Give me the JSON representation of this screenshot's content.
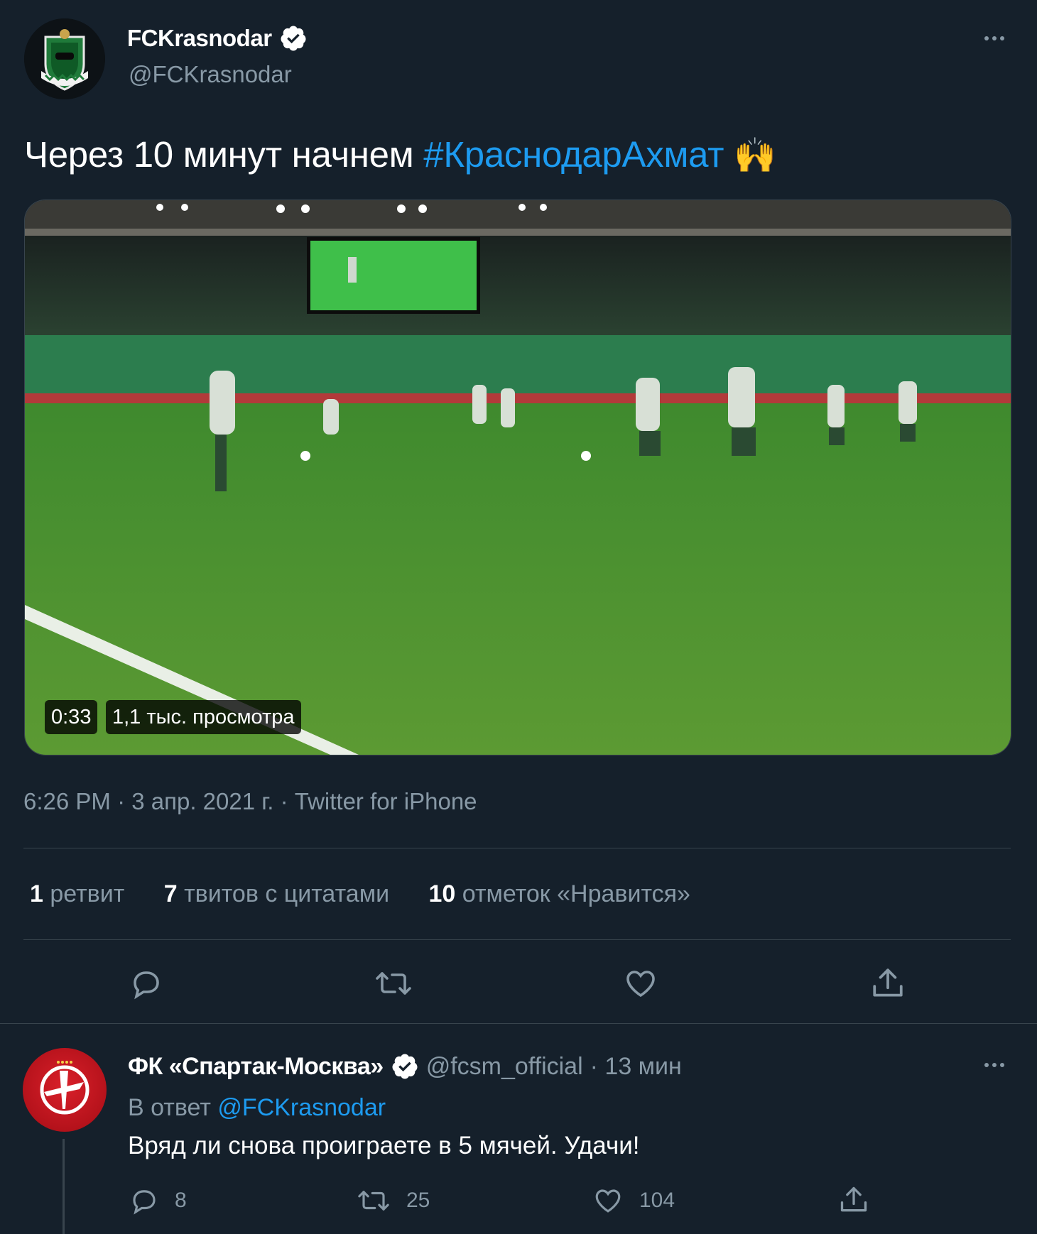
{
  "tweet": {
    "author_name": "FCKrasnodar",
    "author_handle": "@FCKrasnodar",
    "text_plain": "Через 10 минут начнем ",
    "hashtag": "#КраснодарАхмат",
    "emoji": "🙌",
    "media": {
      "duration": "0:33",
      "views": "1,1 тыс. просмотра"
    },
    "meta": "6:26 PM · 3 апр. 2021 г. · Twitter for iPhone",
    "stats": [
      {
        "count": "1",
        "label": "ретвит"
      },
      {
        "count": "7",
        "label": "твитов с цитатами"
      },
      {
        "count": "10",
        "label": "отметок «Нравится»"
      }
    ],
    "actions": [
      "reply-icon",
      "retweet-icon",
      "like-icon",
      "share-icon"
    ]
  },
  "reply": {
    "author_name": "ФК «Спартак-Москва»",
    "author_handle": "@fcsm_official",
    "time": "· 13 мин",
    "reply_to_prefix": "В ответ",
    "reply_to_handle": "@FCKrasnodar",
    "text": "Вряд ли снова проиграете в 5 мячей. Удачи!",
    "counts": {
      "replies": "8",
      "retweets": "25",
      "likes": "104"
    }
  },
  "colors": {
    "background": "#15202b",
    "accent": "#1d9bf0",
    "muted": "#8899a6",
    "divider": "#38444d"
  }
}
